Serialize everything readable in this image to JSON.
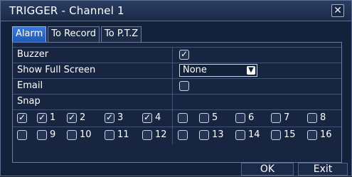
{
  "window": {
    "title": "TRIGGER - Channel 1",
    "close_glyph": "✕"
  },
  "tabs": [
    {
      "label": "Alarm",
      "active": true
    },
    {
      "label": "To Record",
      "active": false
    },
    {
      "label": "To P.T.Z",
      "active": false
    }
  ],
  "fields": {
    "buzzer": {
      "label": "Buzzer",
      "checked": true
    },
    "fullscreen": {
      "label": "Show Full Screen",
      "value": "None"
    },
    "email": {
      "label": "Email",
      "checked": false
    },
    "snap": {
      "label": "Snap"
    }
  },
  "snap_channels": {
    "row1": [
      {
        "label": "",
        "checked": true
      },
      {
        "label": "1",
        "checked": true
      },
      {
        "label": "2",
        "checked": true
      },
      {
        "label": "3",
        "checked": true
      },
      {
        "label": "4",
        "checked": true
      },
      {
        "label": "",
        "checked": false
      },
      {
        "label": "5",
        "checked": false
      },
      {
        "label": "6",
        "checked": false
      },
      {
        "label": "7",
        "checked": false
      },
      {
        "label": "8",
        "checked": false
      }
    ],
    "row2": [
      {
        "label": "",
        "checked": false
      },
      {
        "label": "9",
        "checked": false
      },
      {
        "label": "10",
        "checked": false
      },
      {
        "label": "11",
        "checked": false
      },
      {
        "label": "12",
        "checked": false
      },
      {
        "label": "",
        "checked": false
      },
      {
        "label": "13",
        "checked": false
      },
      {
        "label": "14",
        "checked": false
      },
      {
        "label": "15",
        "checked": false
      },
      {
        "label": "16",
        "checked": false
      }
    ]
  },
  "buttons": {
    "ok": "OK",
    "exit": "Exit"
  }
}
